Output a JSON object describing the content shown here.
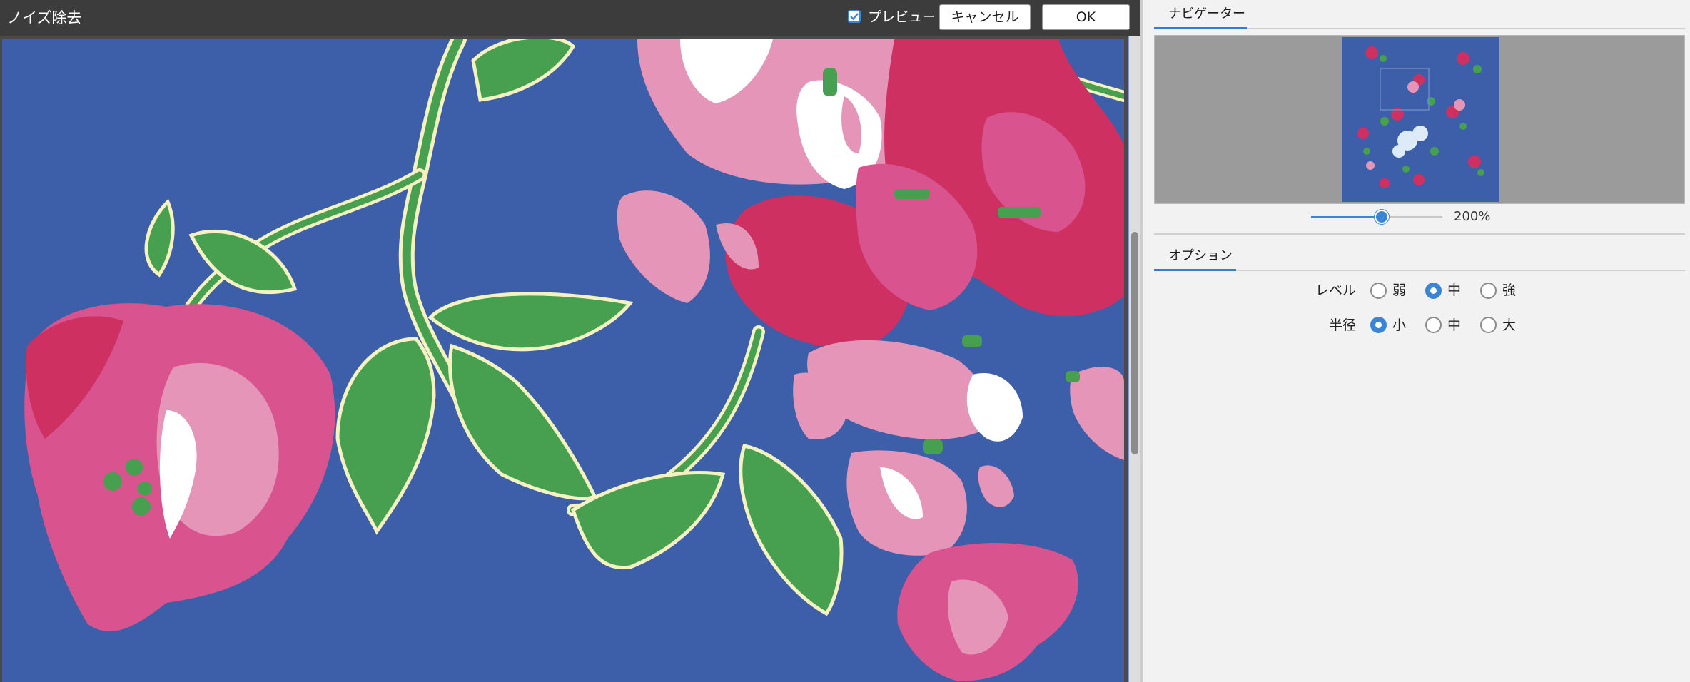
{
  "dialog": {
    "title": "ノイズ除去",
    "preview_label": "プレビュー",
    "preview_checked": true,
    "cancel_label": "キャンセル",
    "ok_label": "OK"
  },
  "navigator": {
    "tab_label": "ナビゲーター",
    "zoom_label": "200%",
    "zoom_percent": 200
  },
  "options": {
    "tab_label": "オプション",
    "level": {
      "label": "レベル",
      "choices": [
        "弱",
        "中",
        "強"
      ],
      "selected": "中"
    },
    "radius": {
      "label": "半径",
      "choices": [
        "小",
        "中",
        "大"
      ],
      "selected": "小"
    }
  },
  "colors": {
    "canvas_background": "#3d5ea8",
    "accent": "#3a86d6",
    "petal_dark": "#cf3062",
    "petal_mid": "#d9548f",
    "petal_light": "#e595b8",
    "leaf": "#46a050",
    "outline": "#f4f2c0"
  }
}
